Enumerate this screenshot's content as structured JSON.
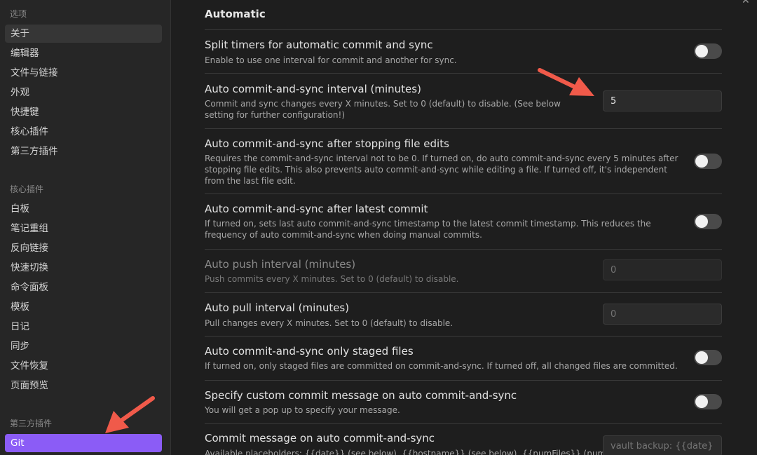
{
  "sidebar": {
    "options_title": "选项",
    "options_items": [
      "关于",
      "编辑器",
      "文件与链接",
      "外观",
      "快捷键",
      "核心插件",
      "第三方插件"
    ],
    "core_title": "核心插件",
    "core_items": [
      "白板",
      "笔记重组",
      "反向链接",
      "快速切换",
      "命令面板",
      "模板",
      "日记",
      "同步",
      "文件恢复",
      "页面预览"
    ],
    "third_title": "第三方插件",
    "third_items": [
      "Git"
    ]
  },
  "main": {
    "heading": "Automatic",
    "settings": [
      {
        "title": "Split timers for automatic commit and sync",
        "desc": "Enable to use one interval for commit and another for sync.",
        "control": "toggle",
        "on": false
      },
      {
        "title": "Auto commit-and-sync interval (minutes)",
        "desc": "Commit and sync changes every X minutes. Set to 0 (default) to disable. (See below setting for further configuration!)",
        "control": "input",
        "value": "5"
      },
      {
        "title": "Auto commit-and-sync after stopping file edits",
        "desc": "Requires the commit-and-sync interval not to be 0. If turned on, do auto commit-and-sync every 5 minutes after stopping file edits. This also prevents auto commit-and-sync while editing a file. If turned off, it's independent from the last file edit.",
        "control": "toggle",
        "on": false
      },
      {
        "title": "Auto commit-and-sync after latest commit",
        "desc": "If turned on, sets last auto commit-and-sync timestamp to the latest commit timestamp. This reduces the frequency of auto commit-and-sync when doing manual commits.",
        "control": "toggle",
        "on": false
      },
      {
        "title": "Auto push interval (minutes)",
        "desc": "Push commits every X minutes. Set to 0 (default) to disable.",
        "control": "input",
        "value": "",
        "placeholder": "0",
        "disabled": true
      },
      {
        "title": "Auto pull interval (minutes)",
        "desc": "Pull changes every X minutes. Set to 0 (default) to disable.",
        "control": "input",
        "value": "",
        "placeholder": "0"
      },
      {
        "title": "Auto commit-and-sync only staged files",
        "desc": "If turned on, only staged files are committed on commit-and-sync. If turned off, all changed files are committed.",
        "control": "toggle",
        "on": false
      },
      {
        "title": "Specify custom commit message on auto commit-and-sync",
        "desc": "You will get a pop up to specify your message.",
        "control": "toggle",
        "on": false
      },
      {
        "title": "Commit message on auto commit-and-sync",
        "desc": "Available placeholders: {{date}} (see below), {{hostname}} (see below), {{numFiles}} (number of",
        "control": "input",
        "value": "",
        "placeholder": "vault backup: {{date}}"
      }
    ]
  },
  "colors": {
    "accent": "#8b5cf6",
    "annotation_arrow": "#f05a4a"
  }
}
